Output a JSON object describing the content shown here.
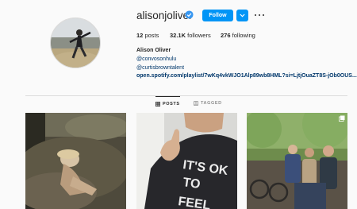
{
  "profile": {
    "username": "alisonjoliver",
    "verified": true,
    "follow_label": "Follow",
    "stats": {
      "posts_count": "12",
      "posts_label": "posts",
      "followers_count": "32.1K",
      "followers_label": "followers",
      "following_count": "276",
      "following_label": "following"
    },
    "bio": {
      "name": "Alison Oliver",
      "lines": [
        "@convosonhulu",
        "@curtisbrowntalent"
      ],
      "link": "open.spotify.com/playlist/7wKq4vkWJO1Alp89wb8HML?si=LjtjOuaZT8S-jOb0OUS..."
    }
  },
  "tabs": [
    {
      "label": "POSTS",
      "active": true,
      "icon": "grid-icon"
    },
    {
      "label": "TAGGED",
      "active": false,
      "icon": "tag-icon"
    }
  ],
  "colors": {
    "accent": "#0095f6",
    "verified": "#3897f0",
    "link": "#00376b"
  },
  "posts": [
    {
      "icon": "photo-outdoor-crouching-person"
    },
    {
      "icon": "photo-thumbs-up-shirt"
    },
    {
      "icon": "photo-group-bikes",
      "multi": true
    }
  ]
}
